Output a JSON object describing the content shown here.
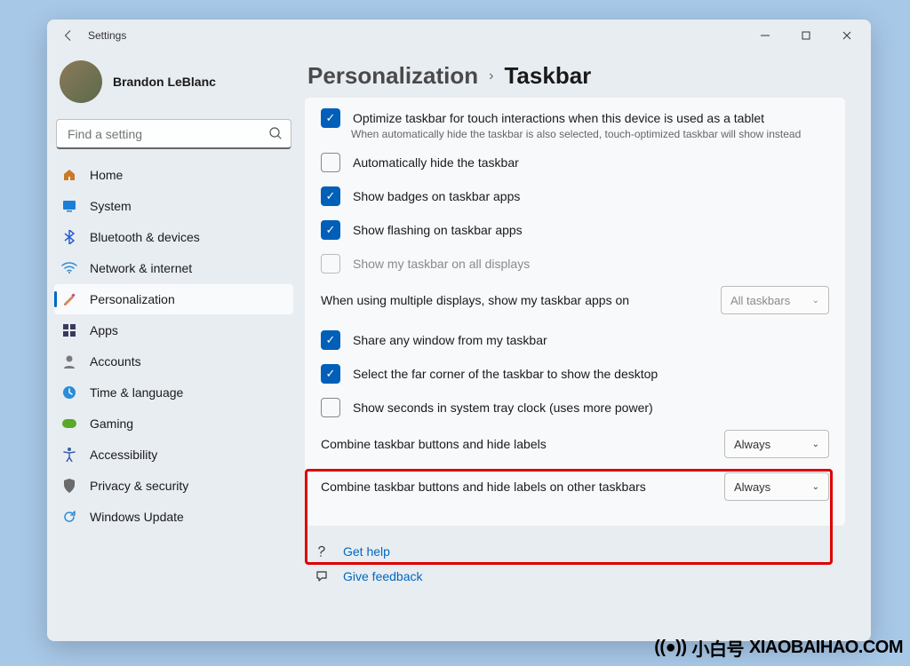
{
  "window": {
    "title": "Settings"
  },
  "profile": {
    "name": "Brandon LeBlanc"
  },
  "search": {
    "placeholder": "Find a setting"
  },
  "nav": [
    {
      "id": "home",
      "label": "Home",
      "color": "#c77b2a"
    },
    {
      "id": "system",
      "label": "System",
      "color": "#1b7fd8"
    },
    {
      "id": "bluetooth",
      "label": "Bluetooth & devices",
      "color": "#285fd6"
    },
    {
      "id": "network",
      "label": "Network & internet",
      "color": "#2a8dd8"
    },
    {
      "id": "personalization",
      "label": "Personalization",
      "color": "#c04a8a",
      "active": true
    },
    {
      "id": "apps",
      "label": "Apps",
      "color": "#3a3a5e"
    },
    {
      "id": "accounts",
      "label": "Accounts",
      "color": "#7a7a7a"
    },
    {
      "id": "time",
      "label": "Time & language",
      "color": "#2a8dd8"
    },
    {
      "id": "gaming",
      "label": "Gaming",
      "color": "#5aa82a"
    },
    {
      "id": "accessibility",
      "label": "Accessibility",
      "color": "#3a5ea8"
    },
    {
      "id": "privacy",
      "label": "Privacy & security",
      "color": "#6a6a6a"
    },
    {
      "id": "update",
      "label": "Windows Update",
      "color": "#2a8dd8"
    }
  ],
  "breadcrumb": {
    "parent": "Personalization",
    "current": "Taskbar"
  },
  "settings": {
    "optimize": {
      "label": "Optimize taskbar for touch interactions when this device is used as a tablet",
      "checked": true,
      "sub": "When automatically hide the taskbar is also selected, touch-optimized taskbar will show instead"
    },
    "autohide": {
      "label": "Automatically hide the taskbar",
      "checked": false
    },
    "badges": {
      "label": "Show badges on taskbar apps",
      "checked": true
    },
    "flashing": {
      "label": "Show flashing on taskbar apps",
      "checked": true
    },
    "alldisplays": {
      "label": "Show my taskbar on all displays",
      "checked": false,
      "disabled": true
    },
    "multidisplay": {
      "label": "When using multiple displays, show my taskbar apps on",
      "value": "All taskbars",
      "disabled": true
    },
    "shareany": {
      "label": "Share any window from my taskbar",
      "checked": true
    },
    "farcorner": {
      "label": "Select the far corner of the taskbar to show the desktop",
      "checked": true
    },
    "seconds": {
      "label": "Show seconds in system tray clock (uses more power)",
      "checked": false
    },
    "combine": {
      "label": "Combine taskbar buttons and hide labels",
      "value": "Always"
    },
    "combineother": {
      "label": "Combine taskbar buttons and hide labels on other taskbars",
      "value": "Always"
    }
  },
  "footer": {
    "help": "Get help",
    "feedback": "Give feedback"
  },
  "watermark": {
    "cn": "小白号",
    "en": "XIAOBAIHAO.COM"
  }
}
